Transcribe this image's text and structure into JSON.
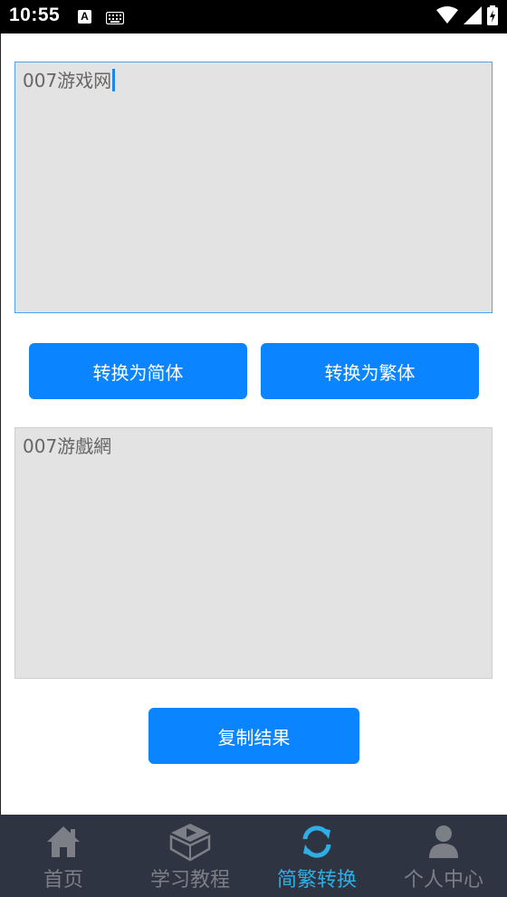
{
  "status_bar": {
    "time": "10:55",
    "notification_letter": "A"
  },
  "converter": {
    "input_text": "007游戏网",
    "result_text": "007游戲網",
    "to_simplified_label": "转换为简体",
    "to_traditional_label": "转换为繁体",
    "copy_label": "复制结果"
  },
  "bottom_nav": {
    "items": [
      {
        "label": "首页",
        "icon": "home-icon",
        "active": false
      },
      {
        "label": "学习教程",
        "icon": "book-play-icon",
        "active": false
      },
      {
        "label": "简繁转换",
        "icon": "sync-icon",
        "active": true
      },
      {
        "label": "个人中心",
        "icon": "user-icon",
        "active": false
      }
    ]
  },
  "colors": {
    "accent": "#0a84ff",
    "nav_active": "#2eaee5",
    "nav_inactive": "#7c7f86",
    "nav_background": "#2e3442",
    "textbox_background": "#e3e3e3"
  }
}
